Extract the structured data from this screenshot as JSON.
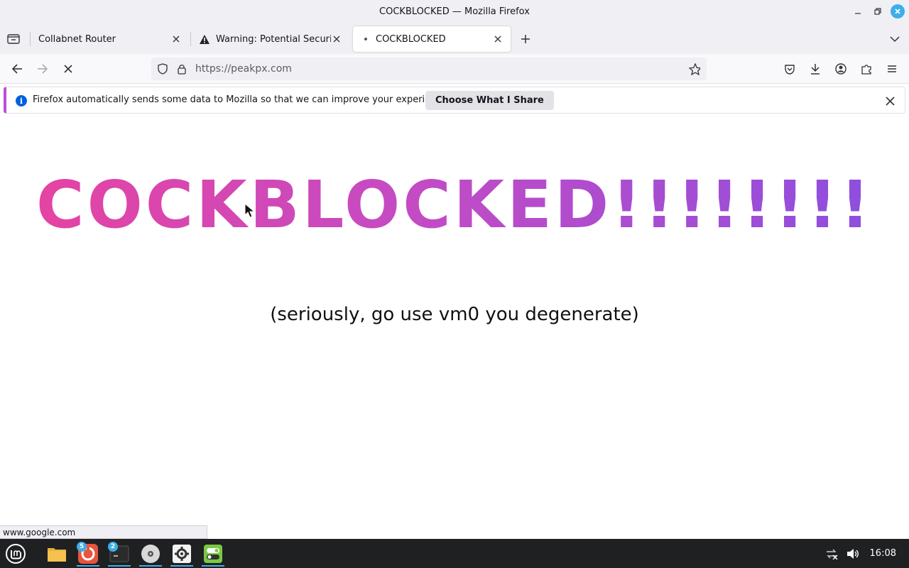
{
  "window": {
    "title": "COCKBLOCKED — Mozilla Firefox",
    "close_color": "#3daee9"
  },
  "tabs": [
    {
      "label": "Collabnet Router",
      "active": false
    },
    {
      "label": "Warning: Potential Security Ri",
      "active": false,
      "icon": "warning-icon"
    },
    {
      "label": "COCKBLOCKED",
      "active": true
    }
  ],
  "navbar": {
    "url": "https://peakpx.com"
  },
  "notification": {
    "text": "Firefox automatically sends some data to Mozilla so that we can improve your experience.",
    "button_label": "Choose What I Share",
    "accent": "#c04bd8"
  },
  "page": {
    "heading": "COCKBLOCKED!!!!!!!!",
    "subtitle": "(seriously, go use vm0 you degenerate)",
    "gradient": [
      "#e8439f",
      "#c44bc4",
      "#8a4fe0"
    ]
  },
  "status": {
    "link_hover": "www.google.com"
  },
  "taskbar": {
    "clock": "16:08",
    "firefox_badge": "5",
    "terminal_badge": "2"
  }
}
